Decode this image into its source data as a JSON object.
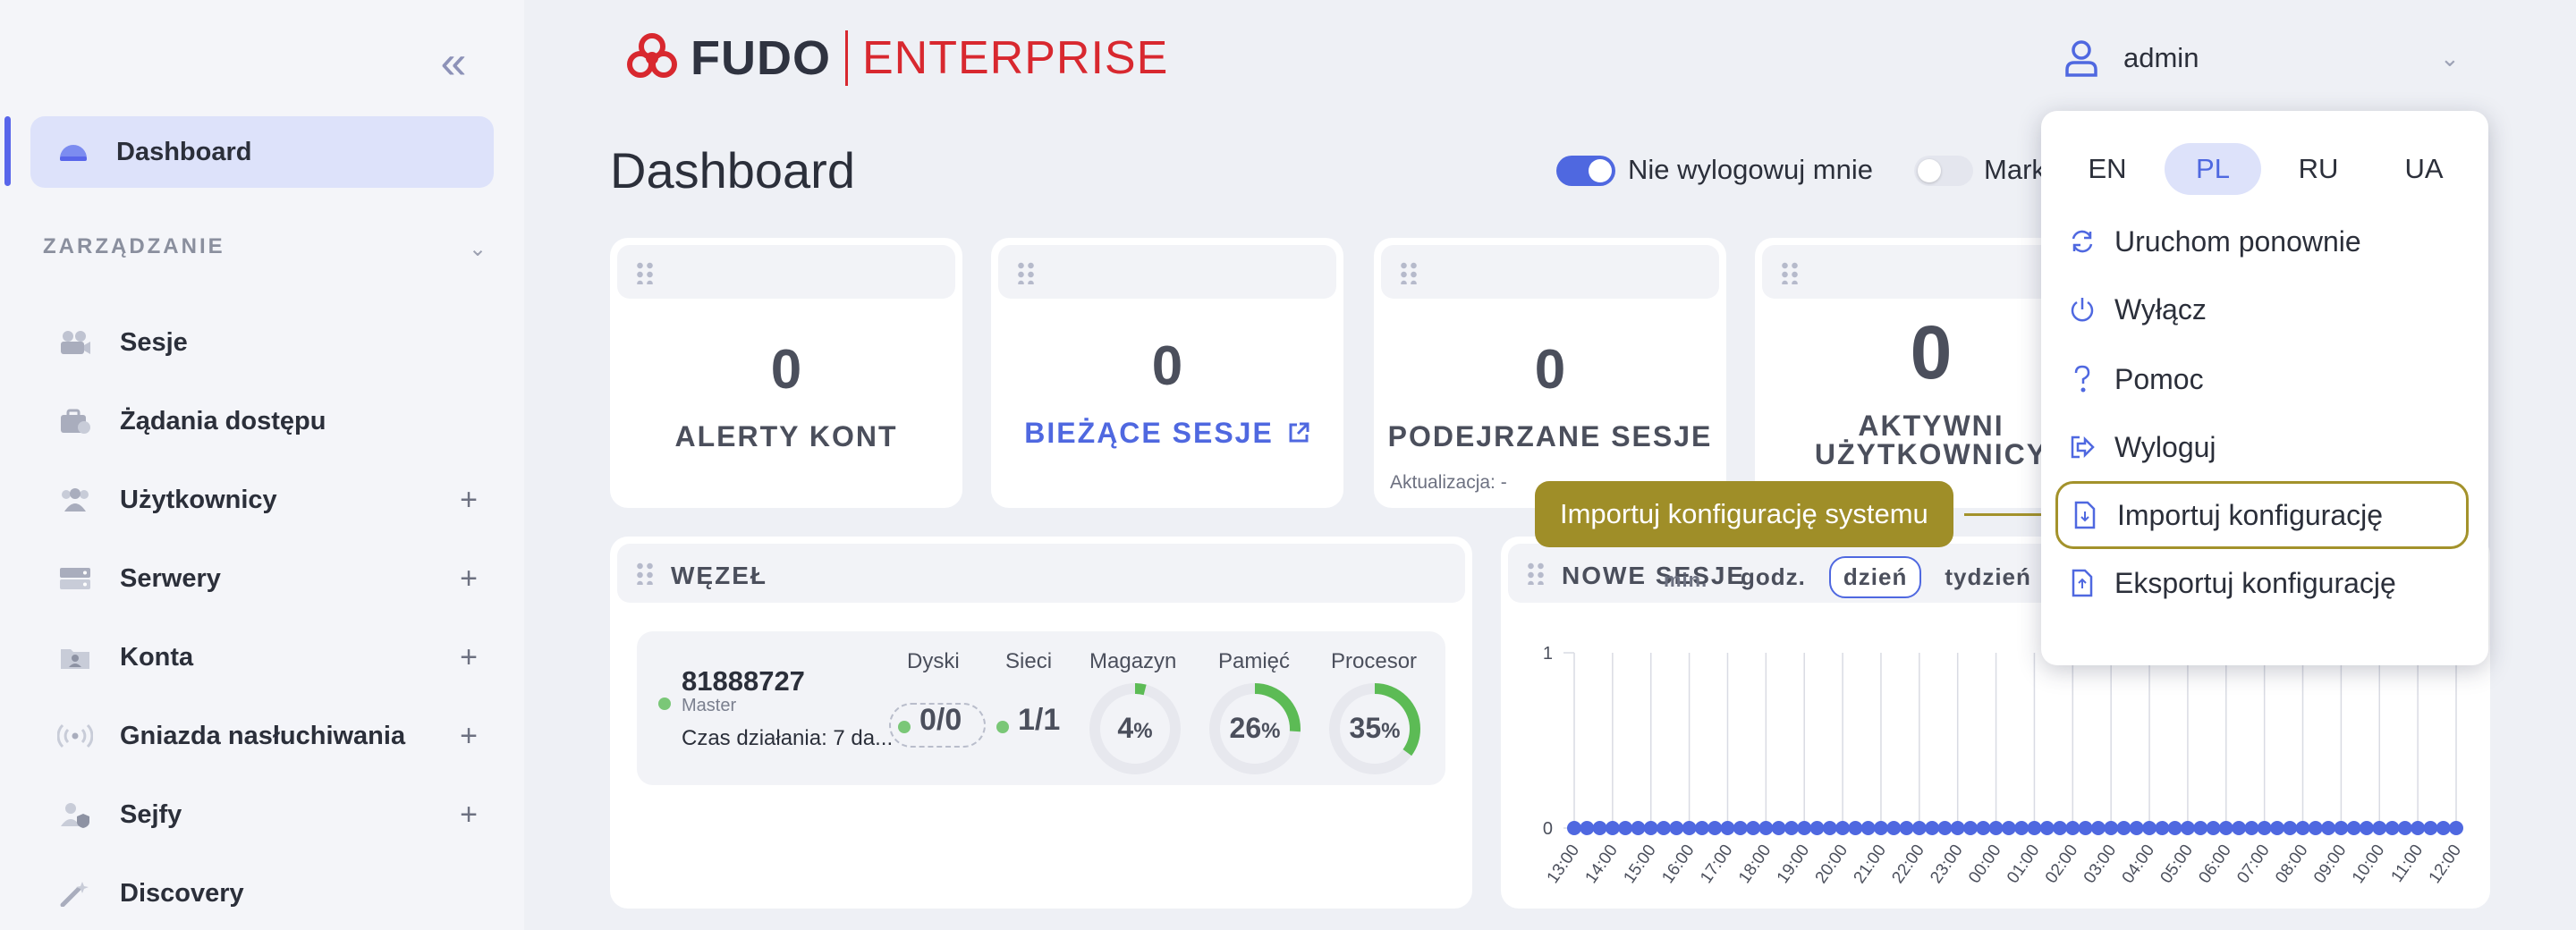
{
  "sidebar": {
    "active_item": "Dashboard",
    "section": "ZARZĄDZANIE",
    "items": [
      {
        "label": "Sesje",
        "icon": "sessions-icon",
        "expandable": false
      },
      {
        "label": "Żądania dostępu",
        "icon": "access-requests-icon",
        "expandable": false
      },
      {
        "label": "Użytkownicy",
        "icon": "users-icon",
        "expandable": true
      },
      {
        "label": "Serwery",
        "icon": "servers-icon",
        "expandable": true
      },
      {
        "label": "Konta",
        "icon": "accounts-icon",
        "expandable": true
      },
      {
        "label": "Gniazda nasłuchiwania",
        "icon": "listeners-icon",
        "expandable": true
      },
      {
        "label": "Sejfy",
        "icon": "safes-icon",
        "expandable": true
      },
      {
        "label": "Discovery",
        "icon": "discovery-icon",
        "expandable": false
      }
    ],
    "plus": "+"
  },
  "header": {
    "logo_fudo": "FUDO",
    "logo_enterprise": "ENTERPRISE",
    "user": "admin"
  },
  "page": {
    "title": "Dashboard",
    "toggle_stay_logged": "Nie wylogowuj mnie",
    "toggle_second": "Mark"
  },
  "stats": [
    {
      "value": "0",
      "label": "ALERTY KONT"
    },
    {
      "value": "0",
      "label": "BIEŻĄCE SESJE"
    },
    {
      "value": "0",
      "label": "PODEJRZANE SESJE",
      "note": "Aktualizacja: -"
    },
    {
      "value": "0",
      "label_line1": "AKTYWNI",
      "label_line2": "UŻYTKOWNICY"
    }
  ],
  "node_panel": {
    "title": "WĘZEŁ",
    "id": "81888727",
    "role": "Master",
    "uptime": "Czas działania: 7 da...",
    "columns": {
      "disks": "Dyski",
      "networks": "Sieci",
      "storage": "Magazyn",
      "memory": "Pamięć",
      "cpu": "Procesor"
    },
    "disks": "0/0",
    "networks": "1/1",
    "storage_pct": 4,
    "memory_pct": 26,
    "cpu_pct": 35,
    "pct_sign": "%"
  },
  "sessions_panel": {
    "title": "NOWE SESJE",
    "tabs": [
      "godz.",
      "dzień",
      "tydzień"
    ],
    "selected_tab": "dzień",
    "overlap_label": "min."
  },
  "chart_data": {
    "type": "line",
    "title": "NOWE SESJE",
    "x": [
      "13:00",
      "14:00",
      "15:00",
      "16:00",
      "17:00",
      "18:00",
      "19:00",
      "20:00",
      "21:00",
      "22:00",
      "23:00",
      "00:00",
      "01:00",
      "02:00",
      "03:00",
      "04:00",
      "05:00",
      "06:00",
      "07:00",
      "08:00",
      "09:00",
      "10:00",
      "11:00",
      "12:00"
    ],
    "series": [
      {
        "values": [
          0,
          0,
          0,
          0,
          0,
          0,
          0,
          0,
          0,
          0,
          0,
          0,
          0,
          0,
          0,
          0,
          0,
          0,
          0,
          0,
          0,
          0,
          0,
          0
        ]
      }
    ],
    "ylim": [
      0,
      1
    ],
    "yticks": [
      "0",
      "1"
    ],
    "grid": true,
    "color": "#4f68e0"
  },
  "menu": {
    "languages": [
      "EN",
      "PL",
      "RU",
      "UA"
    ],
    "selected_language": "PL",
    "items": [
      {
        "label": "Uruchom ponownie",
        "icon": "restart-icon"
      },
      {
        "label": "Wyłącz",
        "icon": "power-icon"
      },
      {
        "label": "Pomoc",
        "icon": "help-icon"
      },
      {
        "label": "Wyloguj",
        "icon": "logout-icon"
      },
      {
        "label": "Importuj konfigurację",
        "icon": "import-file-icon"
      },
      {
        "label": "Eksportuj konfigurację",
        "icon": "export-file-icon"
      }
    ]
  },
  "tooltip": "Importuj konfigurację systemu",
  "colors": {
    "accent": "#4f68e0",
    "brand": "#d8282f",
    "highlight": "#a3922b",
    "ok": "#7ac777",
    "gauge_fill": "#5cbb55"
  }
}
